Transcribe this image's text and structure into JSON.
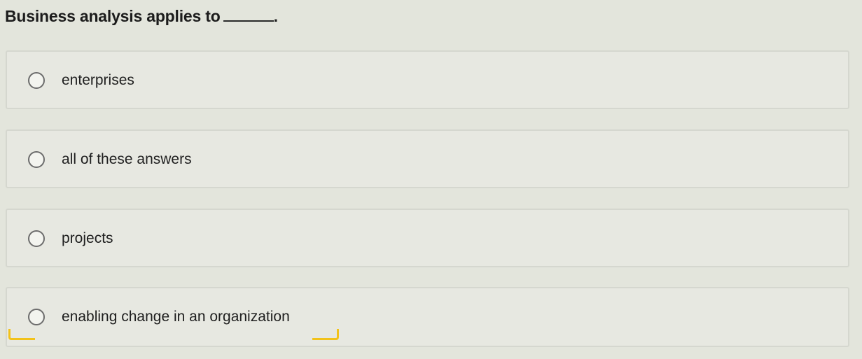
{
  "question": {
    "text": "Business analysis applies to",
    "trailing": "."
  },
  "options": [
    {
      "label": "enterprises",
      "selected": false
    },
    {
      "label": "all of these answers",
      "selected": false
    },
    {
      "label": "projects",
      "selected": false
    },
    {
      "label": "enabling change in an organization",
      "selected": false
    }
  ],
  "colors": {
    "background": "#e3e5dc",
    "focus_ring": "#f2c21a"
  }
}
